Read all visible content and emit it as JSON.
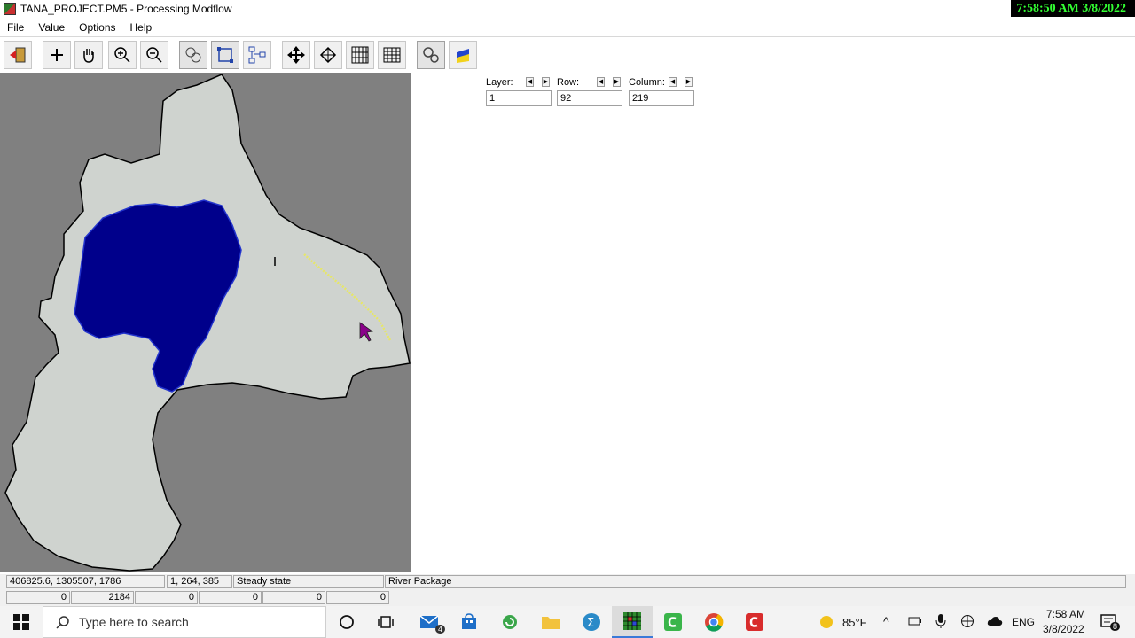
{
  "window": {
    "title": "TANA_PROJECT.PM5 - Processing Modflow",
    "clock": "7:58:50 AM 3/8/2022"
  },
  "menu": [
    "File",
    "Value",
    "Options",
    "Help"
  ],
  "fields": {
    "layer": {
      "label": "Layer:",
      "value": "1"
    },
    "row": {
      "label": "Row:",
      "value": "92"
    },
    "column": {
      "label": "Column:",
      "value": "219"
    }
  },
  "spin_left": "◀",
  "spin_right": "▶",
  "status": {
    "coords": "406825.6,   1305507,     1786",
    "cell": "1, 264, 385",
    "mode": "Steady state",
    "package": "River Package",
    "row2": [
      "0",
      "2184",
      "0",
      "0",
      "0",
      "0"
    ]
  },
  "taskbar": {
    "search_placeholder": "Type here to search",
    "temperature": "85°F",
    "lang": "ENG",
    "time": "7:58 AM",
    "date": "3/8/2022",
    "mail_badge": "4",
    "notif_badge": "8"
  },
  "colors": {
    "lake": "#00008b",
    "domain": "#cfd3cf",
    "river": "#e6e66a",
    "clock_text": "#33ff33",
    "inactive": "#808080"
  }
}
